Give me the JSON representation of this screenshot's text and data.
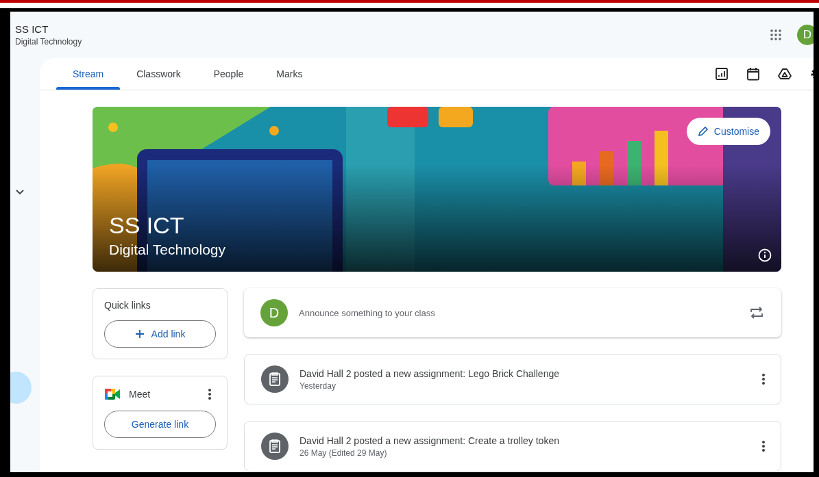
{
  "header": {
    "title": "SS ICT",
    "subtitle": "Digital Technology",
    "avatar": "D"
  },
  "tabs": [
    {
      "label": "Stream",
      "selected": true
    },
    {
      "label": "Classwork",
      "selected": false
    },
    {
      "label": "People",
      "selected": false
    },
    {
      "label": "Marks",
      "selected": false
    }
  ],
  "banner": {
    "title": "SS ICT",
    "subtitle": "Digital Technology",
    "customise_button": "Customise"
  },
  "quick_links": {
    "title": "Quick links",
    "button": "Add link"
  },
  "meet": {
    "title": "Meet",
    "button": "Generate link"
  },
  "announce": {
    "avatar": "D",
    "placeholder": "Announce something to your class"
  },
  "posts": [
    {
      "title": "David Hall 2 posted a new assignment: Lego Brick Challenge",
      "date": "Yesterday"
    },
    {
      "title": "David Hall 2 posted a new assignment: Create a trolley token",
      "date": "26 May (Edited 29 May)"
    }
  ]
}
